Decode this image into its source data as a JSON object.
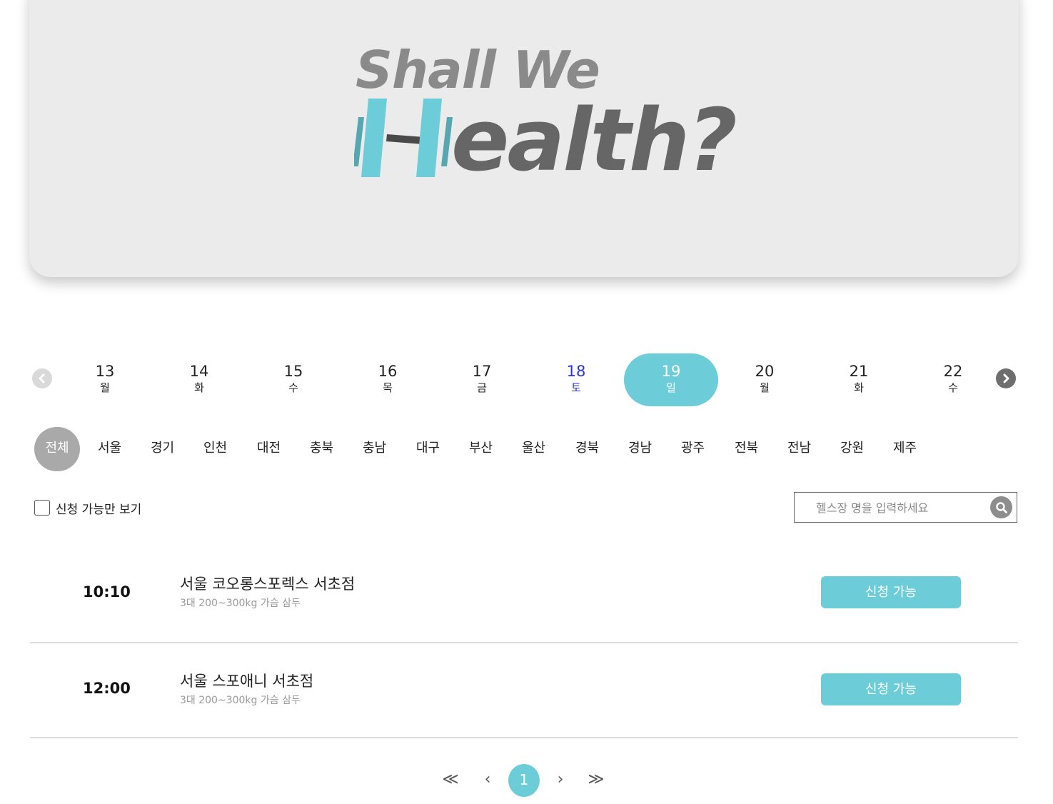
{
  "banner": {
    "logo_line1": "Shall We",
    "logo_line2": "ealth?",
    "colors": {
      "line1": "#8a8a8a",
      "line2": "#666666",
      "accent": "#6ccdd9",
      "accent_dark": "#55a7b1",
      "bar": "#4a4a4a"
    }
  },
  "dates": {
    "prev_icon": "chevron-left-circle",
    "next_icon": "chevron-right-circle",
    "items": [
      {
        "day": "13",
        "weekday": "월"
      },
      {
        "day": "14",
        "weekday": "화"
      },
      {
        "day": "15",
        "weekday": "수"
      },
      {
        "day": "16",
        "weekday": "목"
      },
      {
        "day": "17",
        "weekday": "금"
      },
      {
        "day": "18",
        "weekday": "토"
      },
      {
        "day": "19",
        "weekday": "일"
      },
      {
        "day": "20",
        "weekday": "월"
      },
      {
        "day": "21",
        "weekday": "화"
      },
      {
        "day": "22",
        "weekday": "수"
      }
    ],
    "selected_day": "19"
  },
  "regions": {
    "items": [
      "전체",
      "서울",
      "경기",
      "인천",
      "대전",
      "충북",
      "충남",
      "대구",
      "부산",
      "울산",
      "경북",
      "경남",
      "광주",
      "전북",
      "전남",
      "강원",
      "제주"
    ],
    "selected": "전체"
  },
  "filter": {
    "available_only_label": "신청 가능만 보기",
    "available_only_checked": false
  },
  "search": {
    "placeholder": "헬스장 명을 입력하세요",
    "value": "",
    "icon": "search-icon"
  },
  "sessions": [
    {
      "time": "10:10",
      "name": "서울 코오롱스포렉스 서초점",
      "desc": "3대 200~300kg 가슴 삼두",
      "status": "신청 가능"
    },
    {
      "time": "12:00",
      "name": "서울 스포애니 서초점",
      "desc": "3대 200~300kg 가슴 삼두",
      "status": "신청 가능"
    }
  ],
  "pagination": {
    "first": "≪",
    "prev": "‹",
    "current": "1",
    "next": "›",
    "last": "≫"
  },
  "colors": {
    "accent": "#6ccdd9",
    "saturday": "#2a33d6",
    "region_active_bg": "#a9a9a9",
    "banner_bg": "#ebebeb"
  }
}
